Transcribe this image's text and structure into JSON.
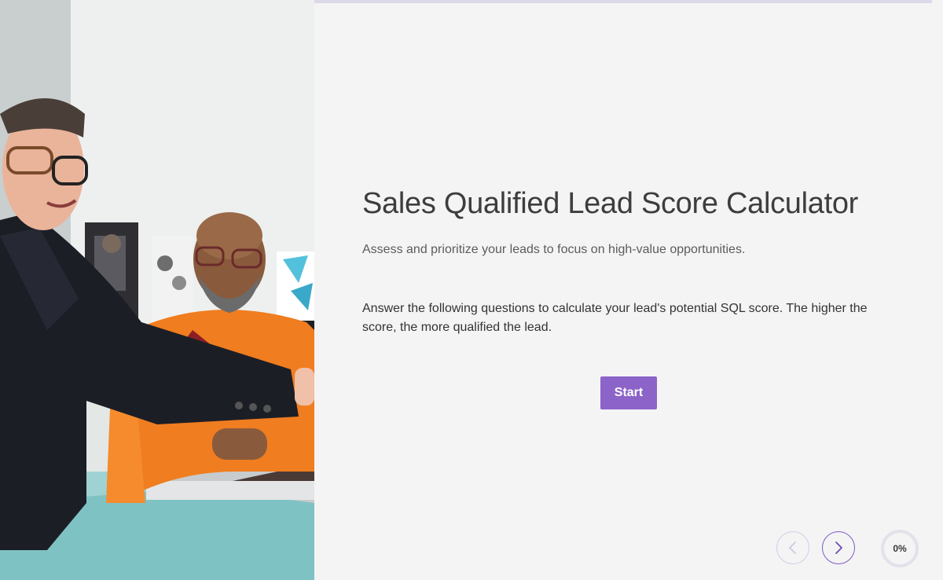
{
  "theme": {
    "accent": "#8c64c9",
    "accent_border": "#7f5cc1",
    "background": "#f4f4f4",
    "progress_bar_track": "#ddd7ea"
  },
  "hero_image": {
    "icon": "photo-two-men-laptop"
  },
  "intro": {
    "title": "Sales Qualified Lead Score Calculator",
    "subtitle": "Assess and prioritize your leads to focus on high-value opportunities.",
    "description": "Answer the following questions to calculate your lead's potential SQL score. The higher the score, the more qualified the lead.",
    "start_label": "Start"
  },
  "navigation": {
    "prev_icon": "chevron-left-icon",
    "next_icon": "chevron-right-icon"
  },
  "progress": {
    "value_fraction": 0,
    "label": "0%"
  }
}
